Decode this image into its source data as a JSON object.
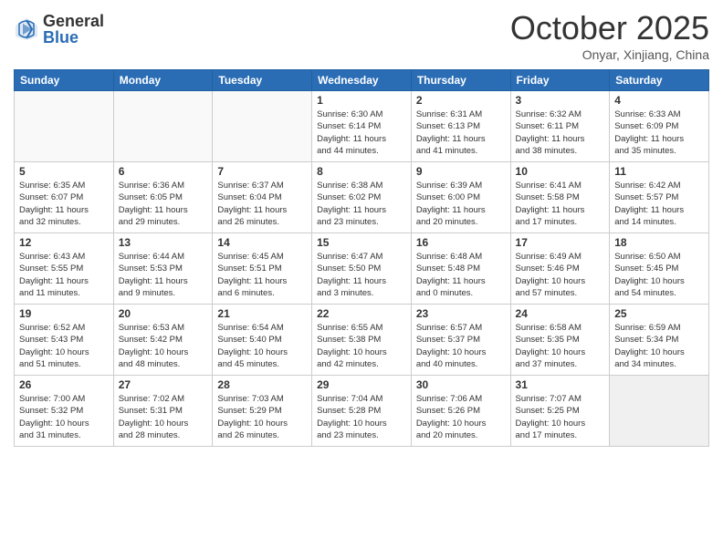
{
  "logo": {
    "general": "General",
    "blue": "Blue"
  },
  "header": {
    "month": "October 2025",
    "location": "Onyar, Xinjiang, China"
  },
  "weekdays": [
    "Sunday",
    "Monday",
    "Tuesday",
    "Wednesday",
    "Thursday",
    "Friday",
    "Saturday"
  ],
  "rows": [
    [
      {
        "day": "",
        "info": ""
      },
      {
        "day": "",
        "info": ""
      },
      {
        "day": "",
        "info": ""
      },
      {
        "day": "1",
        "info": "Sunrise: 6:30 AM\nSunset: 6:14 PM\nDaylight: 11 hours\nand 44 minutes."
      },
      {
        "day": "2",
        "info": "Sunrise: 6:31 AM\nSunset: 6:13 PM\nDaylight: 11 hours\nand 41 minutes."
      },
      {
        "day": "3",
        "info": "Sunrise: 6:32 AM\nSunset: 6:11 PM\nDaylight: 11 hours\nand 38 minutes."
      },
      {
        "day": "4",
        "info": "Sunrise: 6:33 AM\nSunset: 6:09 PM\nDaylight: 11 hours\nand 35 minutes."
      }
    ],
    [
      {
        "day": "5",
        "info": "Sunrise: 6:35 AM\nSunset: 6:07 PM\nDaylight: 11 hours\nand 32 minutes."
      },
      {
        "day": "6",
        "info": "Sunrise: 6:36 AM\nSunset: 6:05 PM\nDaylight: 11 hours\nand 29 minutes."
      },
      {
        "day": "7",
        "info": "Sunrise: 6:37 AM\nSunset: 6:04 PM\nDaylight: 11 hours\nand 26 minutes."
      },
      {
        "day": "8",
        "info": "Sunrise: 6:38 AM\nSunset: 6:02 PM\nDaylight: 11 hours\nand 23 minutes."
      },
      {
        "day": "9",
        "info": "Sunrise: 6:39 AM\nSunset: 6:00 PM\nDaylight: 11 hours\nand 20 minutes."
      },
      {
        "day": "10",
        "info": "Sunrise: 6:41 AM\nSunset: 5:58 PM\nDaylight: 11 hours\nand 17 minutes."
      },
      {
        "day": "11",
        "info": "Sunrise: 6:42 AM\nSunset: 5:57 PM\nDaylight: 11 hours\nand 14 minutes."
      }
    ],
    [
      {
        "day": "12",
        "info": "Sunrise: 6:43 AM\nSunset: 5:55 PM\nDaylight: 11 hours\nand 11 minutes."
      },
      {
        "day": "13",
        "info": "Sunrise: 6:44 AM\nSunset: 5:53 PM\nDaylight: 11 hours\nand 9 minutes."
      },
      {
        "day": "14",
        "info": "Sunrise: 6:45 AM\nSunset: 5:51 PM\nDaylight: 11 hours\nand 6 minutes."
      },
      {
        "day": "15",
        "info": "Sunrise: 6:47 AM\nSunset: 5:50 PM\nDaylight: 11 hours\nand 3 minutes."
      },
      {
        "day": "16",
        "info": "Sunrise: 6:48 AM\nSunset: 5:48 PM\nDaylight: 11 hours\nand 0 minutes."
      },
      {
        "day": "17",
        "info": "Sunrise: 6:49 AM\nSunset: 5:46 PM\nDaylight: 10 hours\nand 57 minutes."
      },
      {
        "day": "18",
        "info": "Sunrise: 6:50 AM\nSunset: 5:45 PM\nDaylight: 10 hours\nand 54 minutes."
      }
    ],
    [
      {
        "day": "19",
        "info": "Sunrise: 6:52 AM\nSunset: 5:43 PM\nDaylight: 10 hours\nand 51 minutes."
      },
      {
        "day": "20",
        "info": "Sunrise: 6:53 AM\nSunset: 5:42 PM\nDaylight: 10 hours\nand 48 minutes."
      },
      {
        "day": "21",
        "info": "Sunrise: 6:54 AM\nSunset: 5:40 PM\nDaylight: 10 hours\nand 45 minutes."
      },
      {
        "day": "22",
        "info": "Sunrise: 6:55 AM\nSunset: 5:38 PM\nDaylight: 10 hours\nand 42 minutes."
      },
      {
        "day": "23",
        "info": "Sunrise: 6:57 AM\nSunset: 5:37 PM\nDaylight: 10 hours\nand 40 minutes."
      },
      {
        "day": "24",
        "info": "Sunrise: 6:58 AM\nSunset: 5:35 PM\nDaylight: 10 hours\nand 37 minutes."
      },
      {
        "day": "25",
        "info": "Sunrise: 6:59 AM\nSunset: 5:34 PM\nDaylight: 10 hours\nand 34 minutes."
      }
    ],
    [
      {
        "day": "26",
        "info": "Sunrise: 7:00 AM\nSunset: 5:32 PM\nDaylight: 10 hours\nand 31 minutes."
      },
      {
        "day": "27",
        "info": "Sunrise: 7:02 AM\nSunset: 5:31 PM\nDaylight: 10 hours\nand 28 minutes."
      },
      {
        "day": "28",
        "info": "Sunrise: 7:03 AM\nSunset: 5:29 PM\nDaylight: 10 hours\nand 26 minutes."
      },
      {
        "day": "29",
        "info": "Sunrise: 7:04 AM\nSunset: 5:28 PM\nDaylight: 10 hours\nand 23 minutes."
      },
      {
        "day": "30",
        "info": "Sunrise: 7:06 AM\nSunset: 5:26 PM\nDaylight: 10 hours\nand 20 minutes."
      },
      {
        "day": "31",
        "info": "Sunrise: 7:07 AM\nSunset: 5:25 PM\nDaylight: 10 hours\nand 17 minutes."
      },
      {
        "day": "",
        "info": ""
      }
    ]
  ]
}
